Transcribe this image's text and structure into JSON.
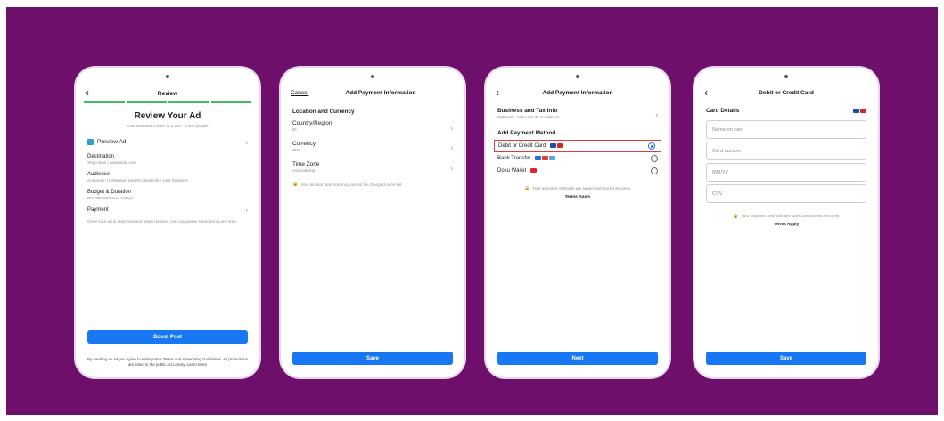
{
  "colors": {
    "background": "#6d0f6b",
    "accent": "#1877f2",
    "progress": "#3fbf5c",
    "highlight": "#e03a3e"
  },
  "screen1": {
    "title": "Review",
    "heading": "Review Your Ad",
    "reach": "Your estimated reach is 1.500 - 3.900 people",
    "preview": "Preview Ad",
    "destination_label": "Destination",
    "destination_value": "Shop Now | www.xialo.com",
    "audience_label": "Audience",
    "audience_value": "Automatic | Instagram targets people like your followers",
    "budget_label": "Budget & Duration",
    "budget_value": "IDR 200.000 over 6 Days",
    "payment_label": "Payment",
    "notice": "Once your ad is approved and starts running, you can pause spending at any time.",
    "button": "Boost Post",
    "legal": "By creating an ad you agree to Instagram's Terms and Advertising Guidelines. All promotions are listed in the public Ad Library. Learn More"
  },
  "screen2": {
    "cancel": "Cancel",
    "title": "Add Payment Information",
    "section": "Location and Currency",
    "country_label": "Country/Region",
    "country_value": "ID",
    "currency_label": "Currency",
    "currency_value": "IDR",
    "timezone_label": "Time Zone",
    "timezone_value": "Asia/Jakarta",
    "note": "Your location and currency cannot be changed once set.",
    "button": "Save"
  },
  "screen3": {
    "title": "Add Payment Information",
    "tax_label": "Business and Tax Info",
    "tax_value": "Optional - Add a tax ID or address",
    "section": "Add Payment Method",
    "method_card": "Debit or Credit Card",
    "method_bank": "Bank Transfer",
    "method_doku": "Doku Wallet",
    "secure_note": "Your payment methods are saved and stored securely.",
    "terms": "Terms Apply",
    "button": "Next"
  },
  "screen4": {
    "title": "Debit or Credit Card",
    "section": "Card Details",
    "name_placeholder": "Name on card",
    "number_placeholder": "Card number",
    "expiry_placeholder": "MM/YY",
    "cvv_placeholder": "CVV",
    "secure_note": "Your payment methods are saved and stored securely.",
    "terms": "Terms Apply",
    "button": "Save"
  }
}
